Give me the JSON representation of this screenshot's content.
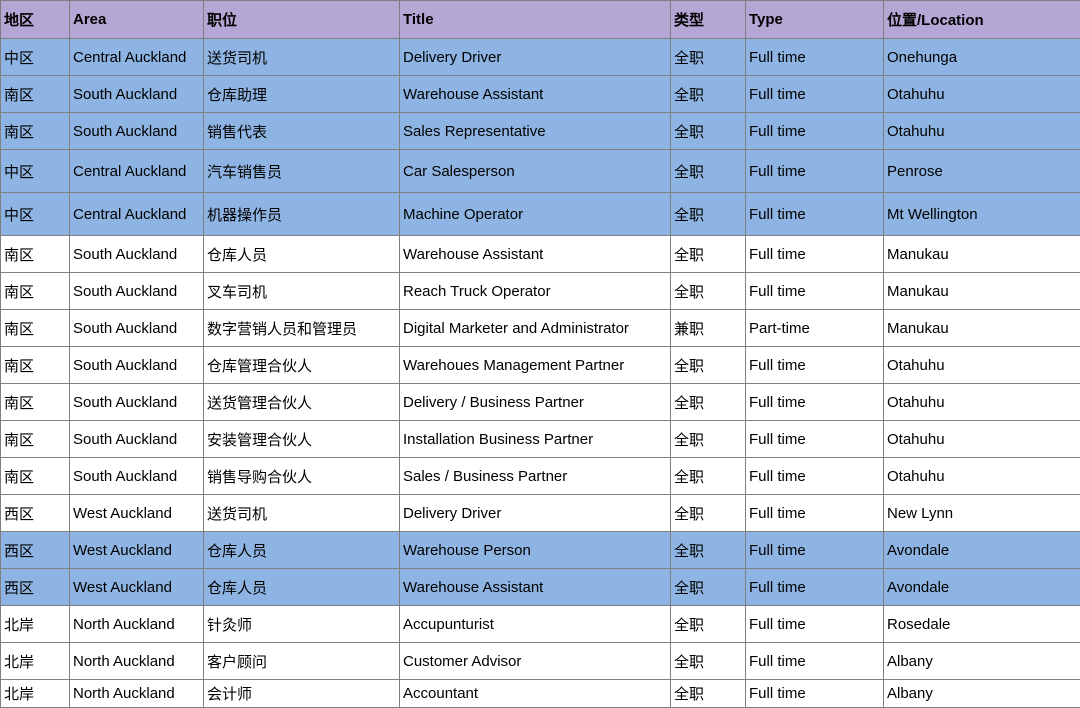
{
  "colors": {
    "header_bg": "#b4a7d6",
    "highlight_bg": "#8eb4e3",
    "plain_bg": "#ffffff",
    "border": "#7f7f7f"
  },
  "table": {
    "headers": [
      "地区",
      "Area",
      "职位",
      "Title",
      "类型",
      "Type",
      "位置/Location"
    ],
    "rows": [
      {
        "h": true,
        "cells": [
          "中区",
          "Central Auckland",
          "送货司机",
          "Delivery Driver",
          "全职",
          "Full time",
          "Onehunga"
        ]
      },
      {
        "h": true,
        "cells": [
          "南区",
          "South Auckland",
          "仓库助理",
          "Warehouse Assistant",
          "全职",
          "Full time",
          "Otahuhu"
        ]
      },
      {
        "h": true,
        "cells": [
          "南区",
          "South Auckland",
          "销售代表",
          "Sales Representative",
          "全职",
          "Full time",
          "Otahuhu"
        ]
      },
      {
        "h": true,
        "cells": [
          "中区",
          "Central Auckland",
          "汽车销售员",
          "Car Salesperson",
          "全职",
          "Full time",
          "Penrose"
        ]
      },
      {
        "h": true,
        "cells": [
          "中区",
          "Central Auckland",
          "机器操作员",
          "Machine Operator",
          "全职",
          "Full time",
          "Mt Wellington"
        ]
      },
      {
        "h": false,
        "cells": [
          "南区",
          "South Auckland",
          "仓库人员",
          "Warehouse Assistant",
          "全职",
          "Full time",
          "Manukau"
        ]
      },
      {
        "h": false,
        "cells": [
          "南区",
          "South Auckland",
          "叉车司机",
          "Reach Truck Operator",
          "全职",
          "Full time",
          "Manukau"
        ]
      },
      {
        "h": false,
        "cells": [
          "南区",
          "South Auckland",
          "数字营销人员和管理员",
          "Digital Marketer and Administrator",
          "兼职",
          "Part-time",
          "Manukau"
        ]
      },
      {
        "h": false,
        "cells": [
          "南区",
          "South Auckland",
          "仓库管理合伙人",
          "Warehoues Management Partner",
          "全职",
          "Full time",
          "Otahuhu"
        ]
      },
      {
        "h": false,
        "cells": [
          "南区",
          "South Auckland",
          "送货管理合伙人",
          "Delivery / Business Partner",
          "全职",
          "Full time",
          "Otahuhu"
        ]
      },
      {
        "h": false,
        "cells": [
          "南区",
          "South Auckland",
          "安装管理合伙人",
          "Installation Business Partner",
          "全职",
          "Full time",
          "Otahuhu"
        ]
      },
      {
        "h": false,
        "cells": [
          "南区",
          "South Auckland",
          "销售导购合伙人",
          "Sales / Business Partner",
          "全职",
          "Full time",
          "Otahuhu"
        ]
      },
      {
        "h": false,
        "cells": [
          "西区",
          "West Auckland",
          "送货司机",
          "Delivery Driver",
          "全职",
          "Full time",
          "New Lynn"
        ]
      },
      {
        "h": true,
        "cells": [
          "西区",
          "West Auckland",
          "仓库人员",
          "Warehouse Person",
          "全职",
          "Full time",
          "Avondale"
        ]
      },
      {
        "h": true,
        "cells": [
          "西区",
          "West Auckland",
          "仓库人员",
          "Warehouse Assistant",
          "全职",
          "Full time",
          "Avondale"
        ]
      },
      {
        "h": false,
        "cells": [
          "北岸",
          "North Auckland",
          "针灸师",
          "Accupunturist",
          "全职",
          "Full time",
          "Rosedale"
        ]
      },
      {
        "h": false,
        "cells": [
          "北岸",
          "North Auckland",
          "客户顾问",
          "Customer Advisor",
          "全职",
          "Full time",
          "Albany"
        ]
      },
      {
        "h": false,
        "cells": [
          "北岸",
          "North Auckland",
          "会计师",
          "Accountant",
          "全职",
          "Full time",
          "Albany"
        ]
      }
    ]
  }
}
